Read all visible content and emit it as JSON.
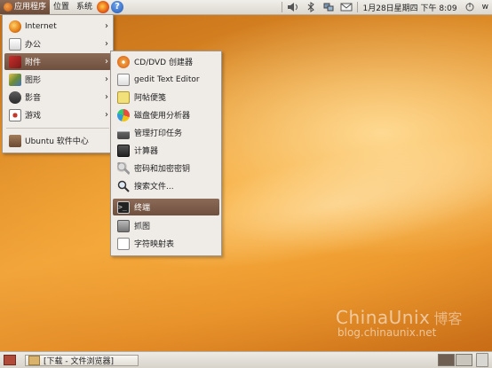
{
  "top_panel": {
    "menus": [
      "应用程序",
      "位置",
      "系统"
    ],
    "clock": "1月28日星期四 下午 8:09",
    "user": "w",
    "help_icon_glyph": "?"
  },
  "main_menu": {
    "items": [
      {
        "label": "Internet",
        "icon": "internet-globe-icon",
        "has_submenu": true
      },
      {
        "label": "办公",
        "icon": "office-icon",
        "has_submenu": true
      },
      {
        "label": "附件",
        "icon": "accessories-icon",
        "has_submenu": true
      },
      {
        "label": "图形",
        "icon": "graphics-icon",
        "has_submenu": true
      },
      {
        "label": "影音",
        "icon": "sound-video-icon",
        "has_submenu": true
      },
      {
        "label": "游戏",
        "icon": "games-icon",
        "has_submenu": true
      },
      {
        "label": "Ubuntu 软件中心",
        "icon": "software-center-icon",
        "has_submenu": false
      }
    ],
    "highlighted": "附件",
    "arrow_glyph": "›"
  },
  "accessories_menu": {
    "items": [
      {
        "label": "CD/DVD 创建器",
        "icon": "cd-burner-icon"
      },
      {
        "label": "gedit Text Editor",
        "icon": "text-editor-icon"
      },
      {
        "label": "阿帖便笺",
        "icon": "sticky-notes-icon"
      },
      {
        "label": "磁盘使用分析器",
        "icon": "disk-usage-icon"
      },
      {
        "label": "管理打印任务",
        "icon": "printer-icon"
      },
      {
        "label": "计算器",
        "icon": "calculator-icon"
      },
      {
        "label": "密码和加密密钥",
        "icon": "keys-icon"
      },
      {
        "label": "搜索文件...",
        "icon": "search-icon"
      },
      {
        "label": "终端",
        "icon": "terminal-icon"
      },
      {
        "label": "抓图",
        "icon": "screenshot-icon"
      },
      {
        "label": "字符映射表",
        "icon": "character-map-icon"
      }
    ],
    "highlighted": "终端"
  },
  "taskbar": {
    "window_button": "[下载 - 文件浏览器]",
    "workspaces": 2
  },
  "watermark": {
    "main": "ChinaUnix",
    "blog": "博客",
    "url": "blog.chinaunix.net"
  },
  "colors": {
    "highlight": "#7a5a47",
    "menu_bg": "#efebe7",
    "desktop_orange": "#e08f2a"
  }
}
